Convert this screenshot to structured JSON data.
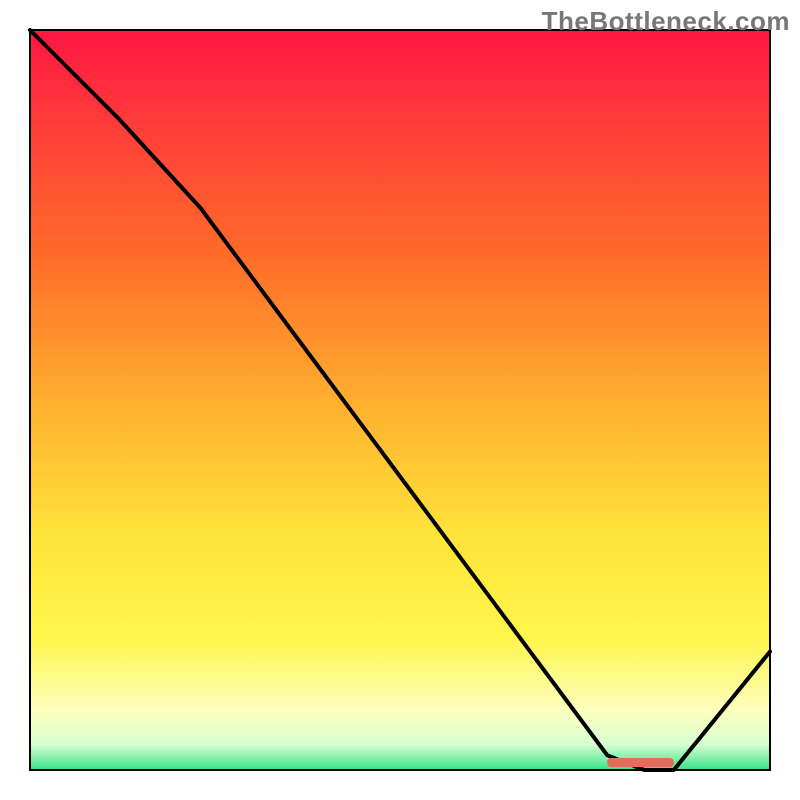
{
  "attribution": "TheBottleneck.com",
  "chart_data": {
    "type": "line",
    "title": "",
    "xlabel": "",
    "ylabel": "",
    "xlim": [
      0,
      100
    ],
    "ylim": [
      0,
      100
    ],
    "series": [
      {
        "name": "curve",
        "x": [
          0,
          12,
          23,
          78,
          83,
          87,
          100
        ],
        "y": [
          100,
          88,
          76,
          2,
          0,
          0,
          16
        ]
      }
    ],
    "optimal_band": {
      "x_start": 78,
      "x_end": 87
    },
    "gradient_stops": [
      {
        "offset": 0.0,
        "color": "#ff1744"
      },
      {
        "offset": 0.12,
        "color": "#ff3a3a"
      },
      {
        "offset": 0.3,
        "color": "#ff6a2a"
      },
      {
        "offset": 0.5,
        "color": "#ffae2e"
      },
      {
        "offset": 0.68,
        "color": "#ffe33a"
      },
      {
        "offset": 0.82,
        "color": "#fff64a"
      },
      {
        "offset": 0.92,
        "color": "#fdffbf"
      },
      {
        "offset": 0.965,
        "color": "#d8ffd0"
      },
      {
        "offset": 1.0,
        "color": "#38e28a"
      }
    ],
    "marker_color": "#e86a5a"
  }
}
